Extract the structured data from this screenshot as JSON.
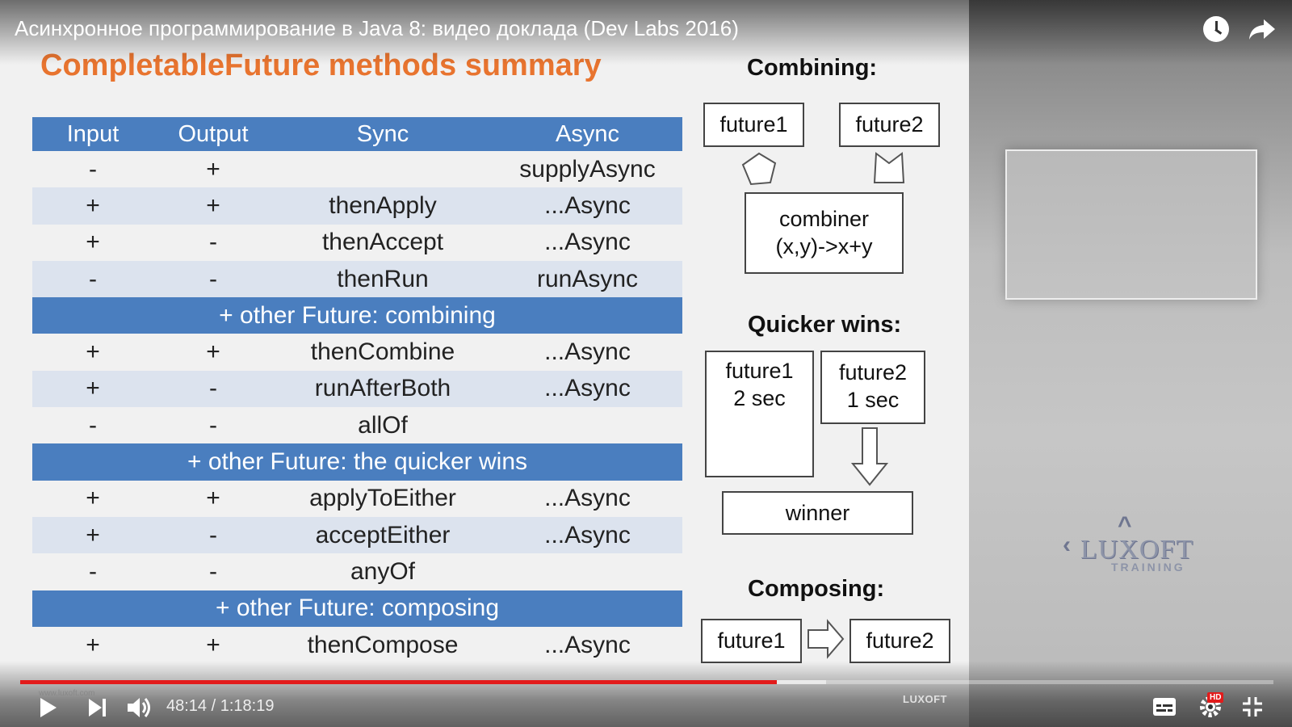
{
  "video": {
    "title": "Асинхронное программирование в Java 8: видео доклада (Dev Labs 2016)"
  },
  "slide": {
    "title": "CompletableFuture methods summary",
    "table": {
      "headers": [
        "Input",
        "Output",
        "Sync",
        "Async"
      ],
      "rows": [
        {
          "type": "row",
          "cells": [
            "-",
            "+",
            "",
            "supplyAsync"
          ]
        },
        {
          "type": "row",
          "cells": [
            "+",
            "+",
            "thenApply",
            "...Async"
          ]
        },
        {
          "type": "row",
          "cells": [
            "+",
            "-",
            "thenAccept",
            "...Async"
          ]
        },
        {
          "type": "row",
          "cells": [
            "-",
            "-",
            "thenRun",
            "runAsync"
          ]
        },
        {
          "type": "section",
          "label": "+ other Future: combining"
        },
        {
          "type": "row",
          "cells": [
            "+",
            "+",
            "thenCombine",
            "...Async"
          ]
        },
        {
          "type": "row",
          "cells": [
            "+",
            "-",
            "runAfterBoth",
            "...Async"
          ]
        },
        {
          "type": "row",
          "cells": [
            "-",
            "-",
            "allOf",
            ""
          ]
        },
        {
          "type": "section",
          "label": "+ other Future: the quicker wins"
        },
        {
          "type": "row",
          "cells": [
            "+",
            "+",
            "applyToEither",
            "...Async"
          ]
        },
        {
          "type": "row",
          "cells": [
            "+",
            "-",
            "acceptEither",
            "...Async"
          ]
        },
        {
          "type": "row",
          "cells": [
            "-",
            "-",
            "anyOf",
            ""
          ]
        },
        {
          "type": "section",
          "label": "+ other Future: composing"
        },
        {
          "type": "row",
          "cells": [
            "+",
            "+",
            "thenCompose",
            "...Async"
          ]
        }
      ]
    },
    "combining": {
      "heading": "Combining:",
      "future1": "future1",
      "future2": "future2",
      "combiner_line1": "combiner",
      "combiner_line2": "(x,y)->x+y"
    },
    "quicker": {
      "heading": "Quicker wins:",
      "future1_line1": "future1",
      "future1_line2": "2 sec",
      "future2_line1": "future2",
      "future2_line2": "1 sec",
      "winner": "winner"
    },
    "composing": {
      "heading": "Composing:",
      "future1": "future1",
      "future2": "future2"
    }
  },
  "watermark": {
    "brand": "LUXOFT",
    "sub": "TRAINING"
  },
  "controls": {
    "url": "www.luxoft.com",
    "current_time": "48:14",
    "separator": " / ",
    "duration": "1:18:19",
    "progress_played_fraction": 0.604,
    "progress_buffered_fraction": 0.643,
    "brand_small": "LUXOFT",
    "hd_badge": "HD",
    "accent": "#e21b1b",
    "icons": [
      "play-icon",
      "next-icon",
      "volume-icon",
      "subtitles-icon",
      "settings-icon",
      "exit-fullscreen-icon",
      "watch-later-icon",
      "share-icon"
    ]
  }
}
